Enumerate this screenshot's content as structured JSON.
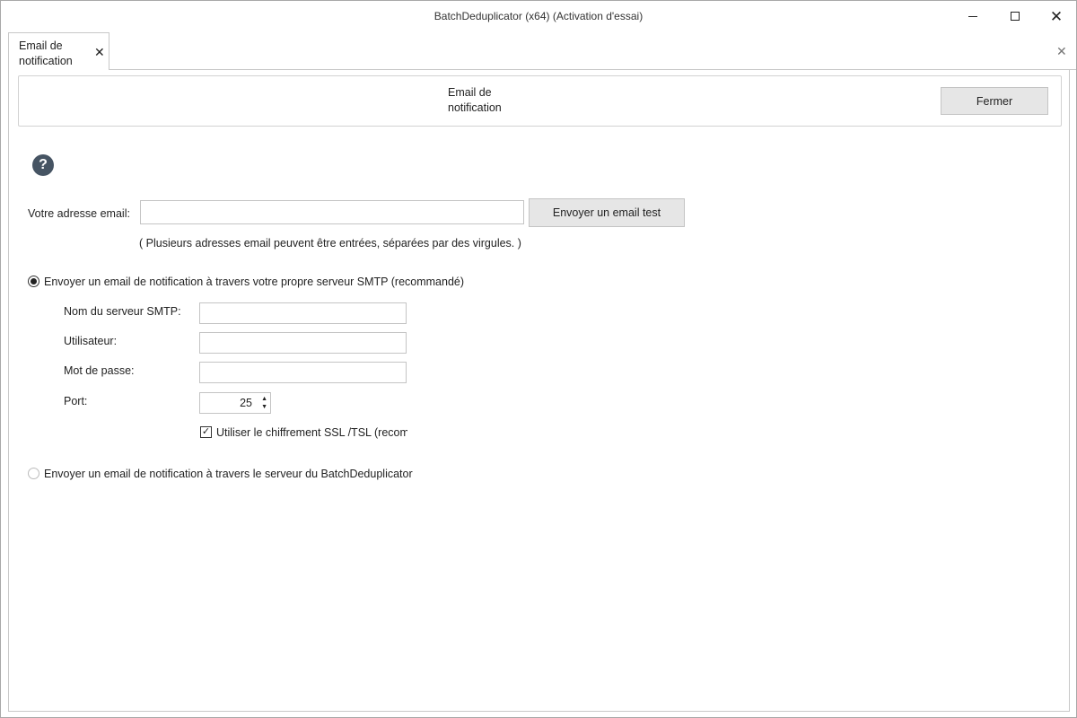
{
  "window": {
    "title": "BatchDeduplicator  (x64) (Activation d'essai)"
  },
  "tabs": [
    {
      "label": "Email de notification",
      "close": "✕"
    }
  ],
  "tabstrip": {
    "close": "✕"
  },
  "header": {
    "title": "Email de notification",
    "close_button": "Fermer"
  },
  "help": {
    "icon": "question-circle-icon",
    "glyph": "?"
  },
  "email": {
    "label": "Votre adresse email:",
    "value": "",
    "test_button": "Envoyer un email test",
    "hint": "( Plusieurs adresses email peuvent être entrées, séparées par des virgules. )"
  },
  "smtp_option": {
    "label": "Envoyer un email de notification à travers votre propre serveur SMTP (recommandé)",
    "selected": true,
    "server_label": "Nom du serveur SMTP:",
    "server_value": "",
    "user_label": "Utilisateur:",
    "user_value": "",
    "password_label": "Mot de passe:",
    "password_value": "",
    "port_label": "Port:",
    "port_value": "25",
    "ssl_label": "Utiliser le chiffrement SSL /TSL (recom",
    "ssl_checked": true
  },
  "server_option": {
    "label": "Envoyer un email de notification à travers le serveur du BatchDeduplicator",
    "selected": false
  }
}
